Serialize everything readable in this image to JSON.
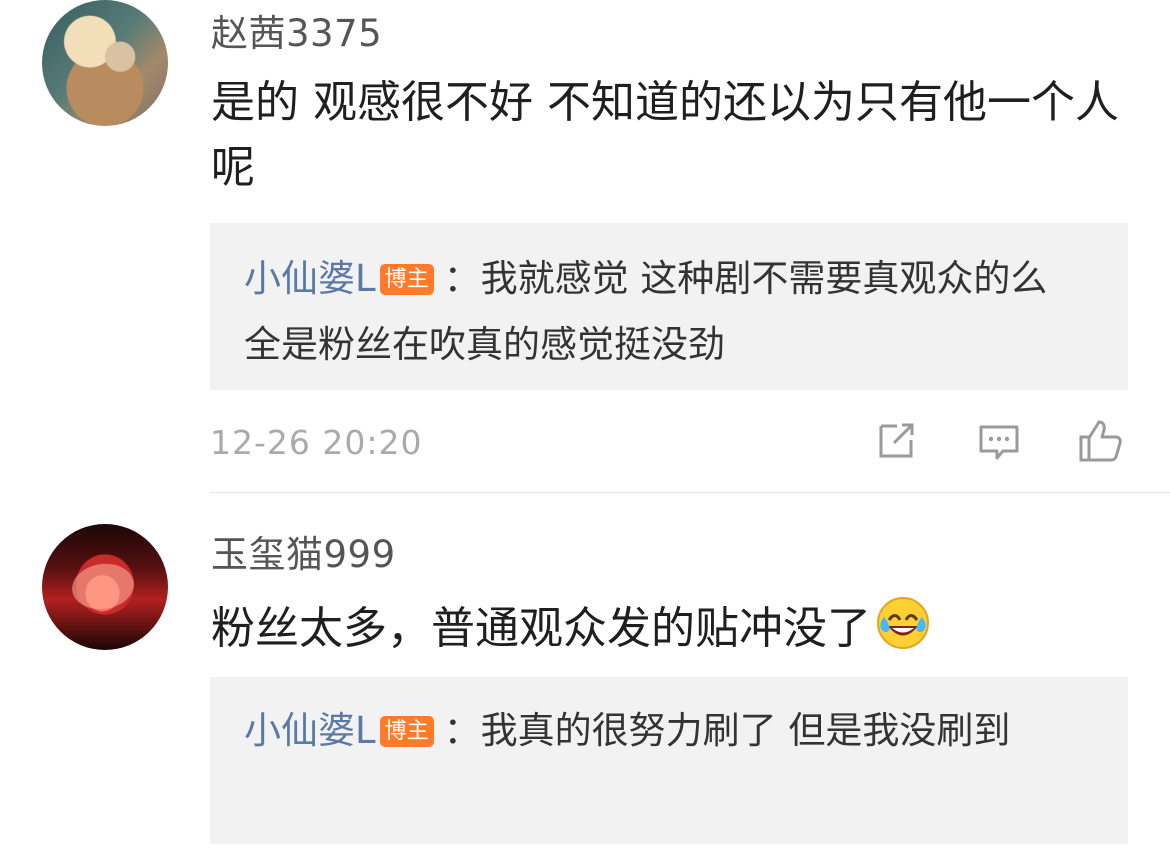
{
  "comments": [
    {
      "username": "赵茜3375",
      "text": "是的 观感很不好  不知道的还以为只有他一个人呢",
      "reply": {
        "user": "小仙婆L",
        "badge": "博主",
        "separator": "：",
        "text": "我就感觉 这种剧不需要真观众的么 全是粉丝在吹真的感觉挺没劲"
      },
      "timestamp": "12-26 20:20",
      "actions": [
        "share-icon",
        "comment-icon",
        "like-icon"
      ]
    },
    {
      "username": "玉玺猫999",
      "text": "粉丝太多，普通观众发的贴冲没了",
      "emoji": "laughing-tears-emoji",
      "reply": {
        "user": "小仙婆L",
        "badge": "博主",
        "separator": "：",
        "text": "我真的很努力刷了 但是我没刷到"
      }
    }
  ],
  "colors": {
    "reply_user": "#5a79a6",
    "badge": "#ff7a29",
    "reply_bg": "#f2f2f2",
    "timestamp": "#aaaaaa"
  }
}
